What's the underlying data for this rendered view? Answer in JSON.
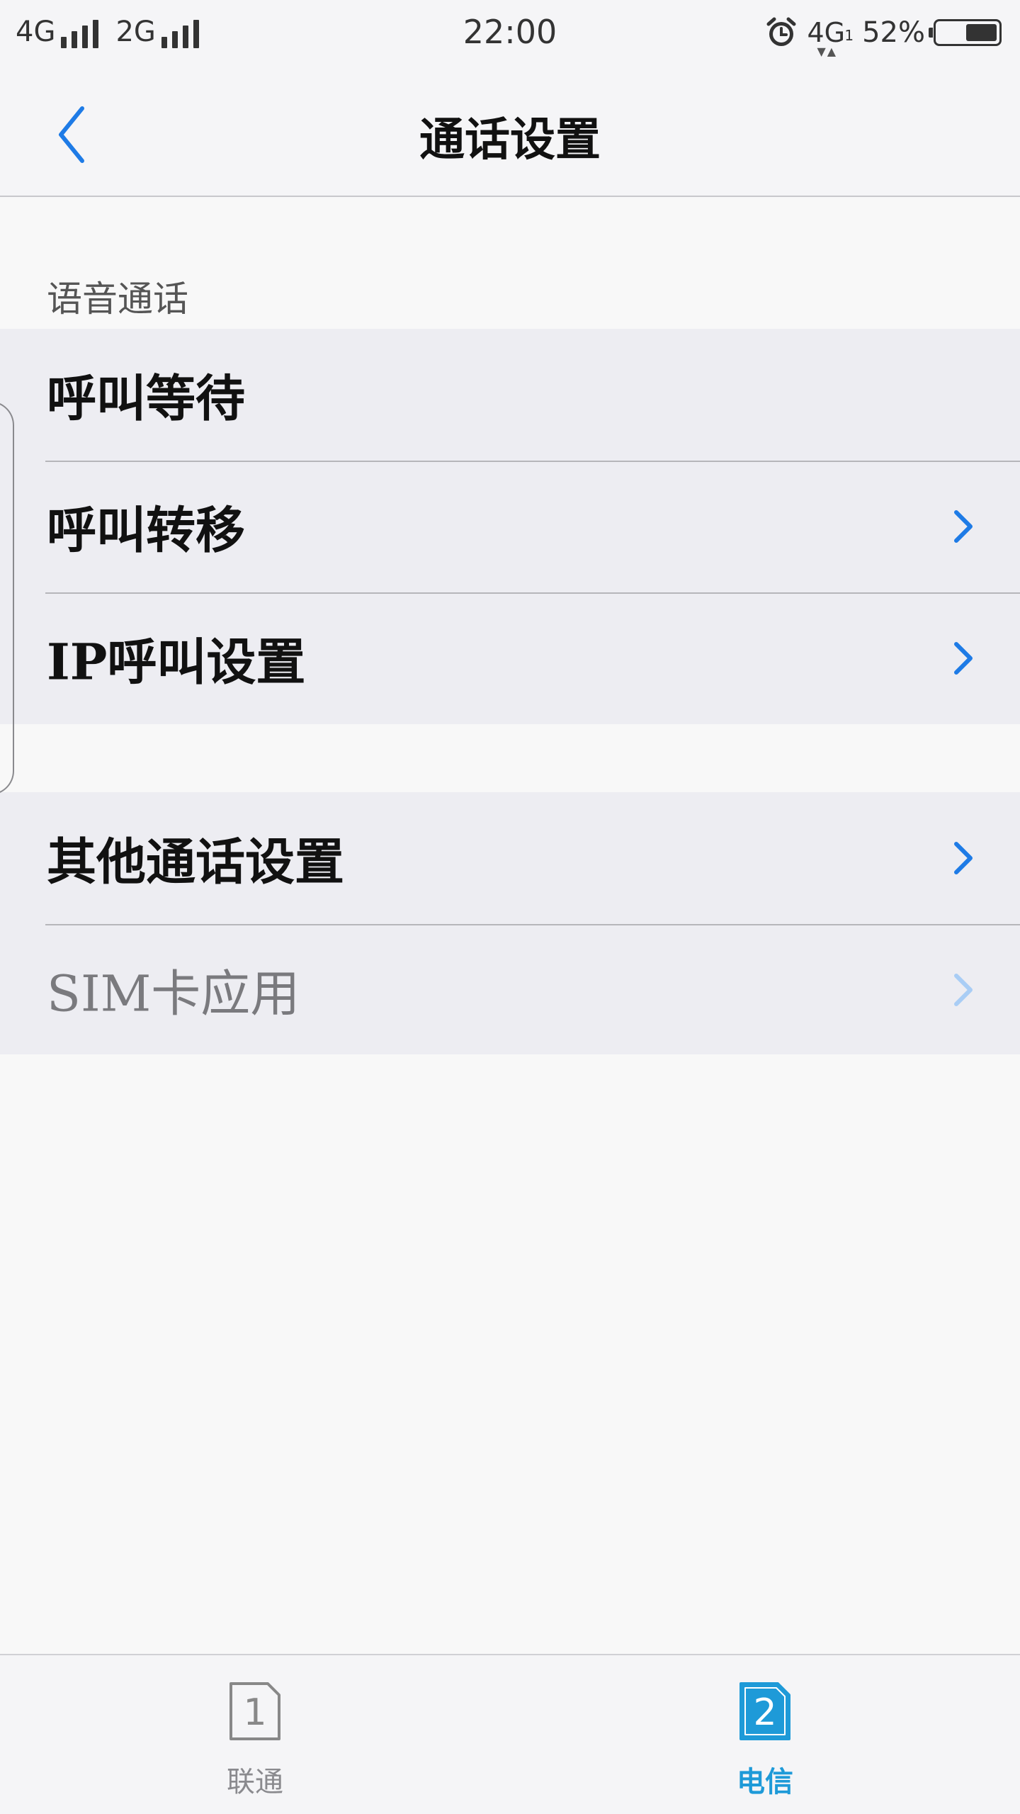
{
  "status_bar": {
    "sim1_network": "4G",
    "sim2_network": "2G",
    "time": "22:00",
    "data_network": "4G",
    "data_network_sub": "1",
    "battery_percent": "52%",
    "battery_level": 0.52
  },
  "nav": {
    "title": "通话设置"
  },
  "section": {
    "header": "语音通话"
  },
  "group1": {
    "items": [
      {
        "label": "呼叫等待"
      },
      {
        "label": "呼叫转移"
      },
      {
        "label": "IP呼叫设置"
      }
    ]
  },
  "group2": {
    "items": [
      {
        "label": "其他通话设置"
      },
      {
        "label": "SIM卡应用"
      }
    ]
  },
  "tabs": [
    {
      "number": "1",
      "label": "联通"
    },
    {
      "number": "2",
      "label": "电信"
    }
  ],
  "colors": {
    "accent": "#1e7be6",
    "active_tab": "#1e9ad8"
  }
}
